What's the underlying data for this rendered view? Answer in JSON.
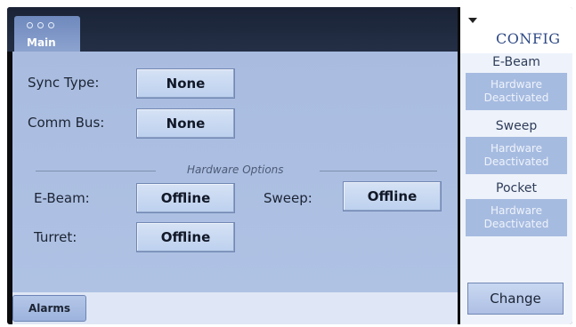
{
  "main_tab": {
    "label": "Main"
  },
  "config": {
    "title": "CONFIG",
    "sections": [
      {
        "name": "E-Beam",
        "status_line1": "Hardware",
        "status_line2": "Deactivated"
      },
      {
        "name": "Sweep",
        "status_line1": "Hardware",
        "status_line2": "Deactivated"
      },
      {
        "name": "Pocket",
        "status_line1": "Hardware",
        "status_line2": "Deactivated"
      }
    ],
    "change_label": "Change"
  },
  "fields": {
    "sync_type": {
      "label": "Sync Type:",
      "value": "None"
    },
    "comm_bus": {
      "label": "Comm Bus:",
      "value": "None"
    }
  },
  "hardware_options": {
    "title": "Hardware Options",
    "ebeam": {
      "label": "E-Beam:",
      "value": "Offline"
    },
    "sweep": {
      "label": "Sweep:",
      "value": "Offline"
    },
    "turret": {
      "label": "Turret:",
      "value": "Offline"
    }
  },
  "footer": {
    "alarms_label": "Alarms"
  }
}
